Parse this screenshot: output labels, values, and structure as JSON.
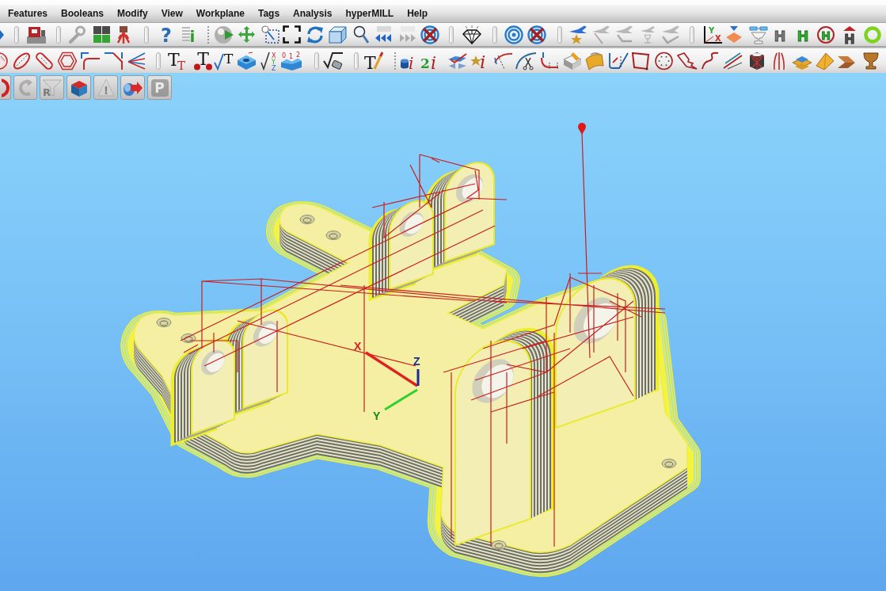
{
  "menu_bar": {
    "items": [
      "Features",
      "Booleans",
      "Modify",
      "View",
      "Workplane",
      "Tags",
      "Analysis",
      "hyperMILL",
      "Help"
    ]
  },
  "toolbar_1": {
    "buttons": [
      {
        "disabled": false
      },
      {
        "disabled": false
      },
      {
        "disabled": false
      },
      {
        "disabled": false
      },
      {
        "disabled": false
      },
      {
        "disabled": false,
        "glyphs": [
          "?"
        ]
      },
      {
        "disabled": false,
        "glyphs": [
          "i"
        ]
      },
      {
        "disabled": false
      },
      {
        "disabled": false
      },
      {
        "disabled": false
      },
      {
        "disabled": false
      },
      {
        "disabled": false
      },
      {
        "disabled": false
      },
      {
        "disabled": false
      },
      {
        "disabled": false
      },
      {
        "disabled": true
      },
      {
        "disabled": false
      },
      {
        "disabled": false
      },
      {
        "disabled": false
      },
      {
        "disabled": false
      },
      {
        "disabled": false
      },
      {
        "disabled": true
      },
      {
        "disabled": true
      },
      {
        "disabled": true
      },
      {
        "disabled": true
      },
      {
        "disabled": false,
        "glyphs": [
          "Y",
          "X"
        ]
      },
      {
        "disabled": false
      },
      {
        "disabled": false
      },
      {
        "disabled": false,
        "glyphs": [
          "H"
        ]
      },
      {
        "disabled": false,
        "glyphs": [
          "H"
        ]
      },
      {
        "disabled": false,
        "glyphs": [
          "H"
        ]
      },
      {
        "disabled": false,
        "glyphs": [
          "H"
        ]
      },
      {
        "disabled": false
      }
    ]
  },
  "toolbar_2": {
    "buttons": [
      {
        "disabled": false
      },
      {
        "disabled": false
      },
      {
        "disabled": false
      },
      {
        "disabled": false
      },
      {
        "disabled": false
      },
      {
        "disabled": false
      },
      {
        "disabled": false
      },
      {
        "disabled": false,
        "glyphs": [
          "T",
          "T"
        ]
      },
      {
        "disabled": false,
        "glyphs": [
          "T"
        ]
      },
      {
        "disabled": false,
        "glyphs": [
          "T"
        ]
      },
      {
        "disabled": false
      },
      {
        "disabled": false,
        "glyphs": [
          "X",
          "Y",
          "Z"
        ]
      },
      {
        "disabled": false,
        "glyphs": [
          "0",
          "1",
          "2"
        ]
      },
      {
        "disabled": false
      },
      {
        "disabled": false,
        "glyphs": [
          "T"
        ]
      },
      {
        "disabled": false,
        "glyphs": [
          "i"
        ]
      },
      {
        "disabled": false,
        "glyphs": [
          "2",
          "i"
        ]
      },
      {
        "disabled": false
      },
      {
        "disabled": false,
        "glyphs": [
          "i"
        ]
      },
      {
        "disabled": false
      },
      {
        "disabled": false
      },
      {
        "disabled": false
      },
      {
        "disabled": false
      },
      {
        "disabled": false
      },
      {
        "disabled": false
      },
      {
        "disabled": false
      },
      {
        "disabled": false
      },
      {
        "disabled": false
      },
      {
        "disabled": false
      },
      {
        "disabled": false
      },
      {
        "disabled": false
      },
      {
        "disabled": false
      },
      {
        "disabled": false
      },
      {
        "disabled": false
      },
      {
        "disabled": false
      },
      {
        "disabled": false
      }
    ]
  },
  "toolbar_3": {
    "buttons": [
      {
        "disabled": false
      },
      {
        "disabled": true
      },
      {
        "disabled": true,
        "glyphs": [
          "R"
        ]
      },
      {
        "disabled": false
      },
      {
        "disabled": true,
        "glyphs": [
          "!"
        ]
      },
      {
        "disabled": false
      },
      {
        "disabled": true,
        "glyphs": [
          "P"
        ]
      }
    ]
  },
  "viewport": {
    "axis_labels": {
      "x": "X",
      "y": "Y",
      "z": "Z"
    }
  }
}
